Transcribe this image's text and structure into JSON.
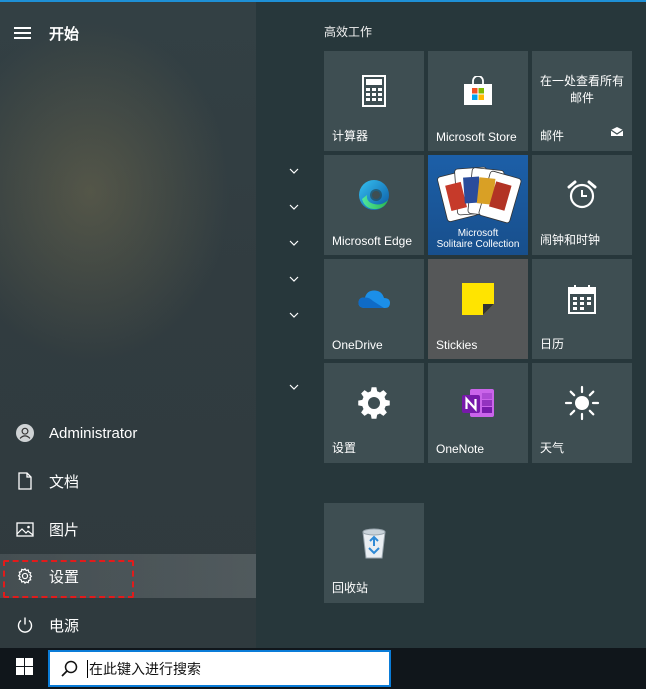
{
  "start": {
    "title": "开始"
  },
  "nav": {
    "user": "Administrator",
    "documents": "文档",
    "pictures": "图片",
    "settings": "设置",
    "power": "电源"
  },
  "tiles_group": {
    "title": "高效工作"
  },
  "tiles": {
    "calculator": "计算器",
    "store": "Microsoft Store",
    "mail_top": "在一处查看所有邮件",
    "mail": "邮件",
    "edge": "Microsoft Edge",
    "solitaire_line1": "Microsoft",
    "solitaire_line2": "Solitaire Collection",
    "alarms": "闹钟和时钟",
    "onedrive": "OneDrive",
    "stickies": "Stickies",
    "calendar": "日历",
    "settings": "设置",
    "onenote": "OneNote",
    "weather": "天气",
    "recycle_bin": "回收站"
  },
  "taskbar": {
    "search_placeholder": "在此键入进行搜索"
  },
  "colors": {
    "accent": "#0a7cd8",
    "tile_bg": "#3e4e52",
    "highlight": "#e21b1b"
  }
}
